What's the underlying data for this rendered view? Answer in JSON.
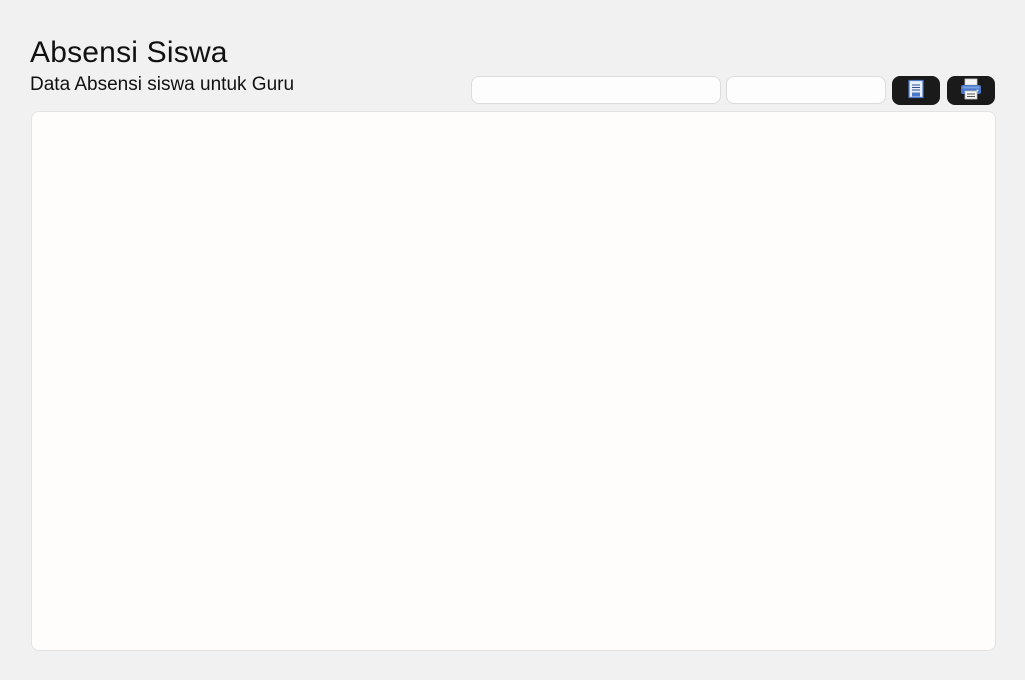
{
  "header": {
    "title": "Absensi Siswa",
    "subtitle": "Data Absensi siswa untuk Guru"
  },
  "toolbar": {
    "filter_1": {
      "value": "",
      "placeholder": ""
    },
    "filter_2": {
      "value": "",
      "placeholder": ""
    },
    "save_button": {
      "icon": "save-document-icon"
    },
    "print_button": {
      "icon": "printer-icon"
    }
  },
  "content": {
    "panel": "attendance-data-panel"
  },
  "colors": {
    "background": "#f1f1f1",
    "panel": "#fefdfc",
    "button": "#1a1a1a",
    "icon_blue": "#4a78c8"
  }
}
